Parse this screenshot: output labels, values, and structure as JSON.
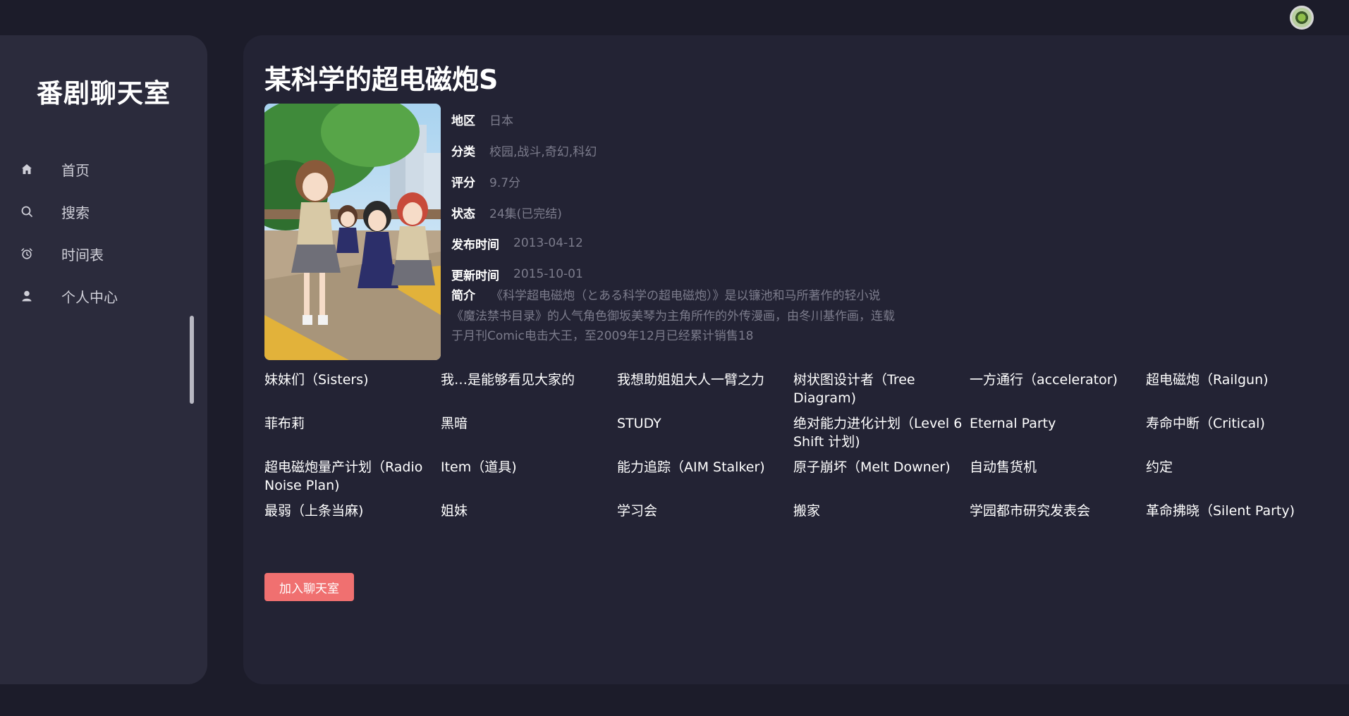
{
  "brand": {
    "title": "番剧聊天室"
  },
  "sidebar": {
    "items": [
      {
        "label": "首页",
        "icon": "home-icon"
      },
      {
        "label": "搜索",
        "icon": "search-icon"
      },
      {
        "label": "时间表",
        "icon": "alarm-clock-icon"
      },
      {
        "label": "个人中心",
        "icon": "user-icon"
      }
    ]
  },
  "anime": {
    "title": "某科学的超电磁炮S",
    "info": [
      {
        "key": "地区",
        "value": "日本"
      },
      {
        "key": "分类",
        "value": "校园,战斗,奇幻,科幻"
      },
      {
        "key": "评分",
        "value": "9.7分"
      },
      {
        "key": "状态",
        "value": "24集(已完结)"
      },
      {
        "key": "发布时间",
        "value": "2013-04-12"
      },
      {
        "key": "更新时间",
        "value": "2015-10-01"
      }
    ],
    "synopsis_key": "简介",
    "synopsis": "《科学超电磁炮（とある科学の超电磁炮）》是以镰池和马所著作的轻小说《魔法禁书目录》的人气角色御坂美琴为主角所作的外传漫画，由冬川基作画，连载于月刊Comic电击大王，至2009年12月已经累计销售18"
  },
  "episodes": [
    "妹妹们（Sisters)",
    "我…是能够看见大家的",
    "我想助姐姐大人一臂之力",
    "树状图设计者（Tree Diagram)",
    "一方通行（accelerator)",
    "超电磁炮（Railgun)",
    "菲布莉",
    "黑暗",
    "STUDY",
    "绝对能力进化计划（Level 6 Shift 计划)",
    "Eternal Party",
    "寿命中断（Critical)",
    "超电磁炮量产计划（Radio Noise Plan)",
    "Item（道具)",
    "能力追踪（AIM Stalker)",
    "原子崩坏（Melt Downer)",
    "自动售货机",
    "约定",
    "最弱（上条当麻)",
    "姐妹",
    "学习会",
    "搬家",
    "学园都市研究发表会",
    "革命拂晓（Silent Party)"
  ],
  "actions": {
    "join_label": "加入聊天室"
  },
  "colors": {
    "background": "#1c1c2a",
    "sidebar": "#2b2b3c",
    "card": "#232334",
    "accent_button": "#f07070",
    "muted_text": "#7c7c8c"
  }
}
